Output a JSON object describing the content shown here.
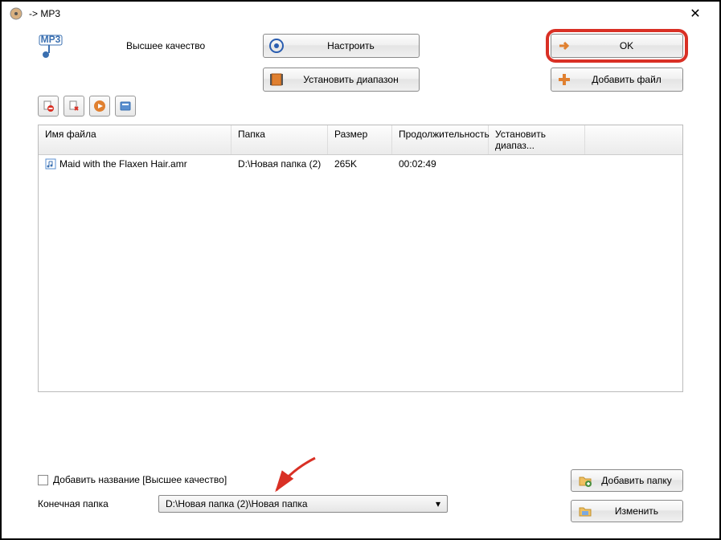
{
  "titlebar": {
    "title": "-> MP3"
  },
  "quality_label": "Высшее качество",
  "buttons": {
    "configure": "Настроить",
    "set_range": "Установить диапазон",
    "ok": "OK",
    "add_file": "Добавить файл",
    "add_folder": "Добавить папку",
    "change": "Изменить"
  },
  "table": {
    "headers": {
      "filename": "Имя файла",
      "folder": "Папка",
      "size": "Размер",
      "duration": "Продолжительность",
      "range": "Установить диапаз..."
    },
    "rows": [
      {
        "filename": "Maid with the Flaxen Hair.amr",
        "folder": "D:\\Новая папка (2)",
        "size": "265K",
        "duration": "00:02:49",
        "range": ""
      }
    ]
  },
  "checkbox_label": "Добавить название [Высшее качество]",
  "dest_label": "Конечная папка",
  "dest_value": "D:\\Новая папка (2)\\Новая папка"
}
